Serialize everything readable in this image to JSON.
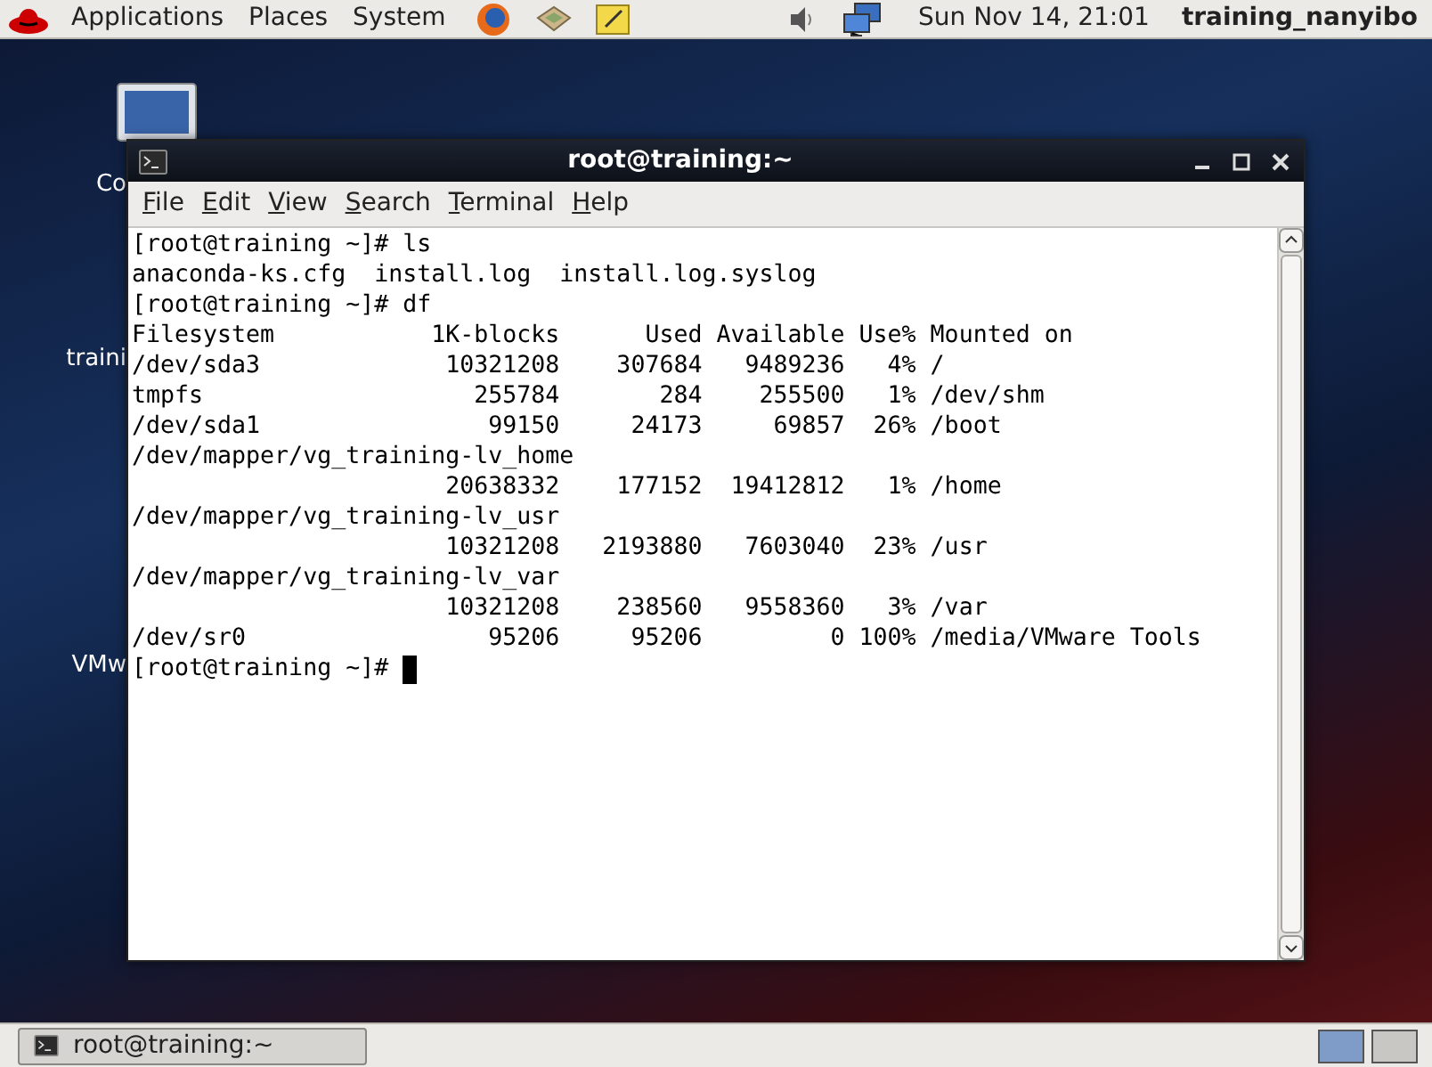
{
  "top_panel": {
    "menus": [
      "Applications",
      "Places",
      "System"
    ],
    "clock": "Sun Nov 14, 21:01",
    "user": "training_nanyibo"
  },
  "desktop_icons": [
    {
      "label": "Co"
    },
    {
      "label": "traini"
    },
    {
      "label": "VMw"
    }
  ],
  "window": {
    "title": "root@training:~",
    "menu": [
      "File",
      "Edit",
      "View",
      "Search",
      "Terminal",
      "Help"
    ],
    "lines": [
      "[root@training ~]# ls",
      "anaconda-ks.cfg  install.log  install.log.syslog",
      "[root@training ~]# df",
      "Filesystem           1K-blocks      Used Available Use% Mounted on",
      "/dev/sda3             10321208    307684   9489236   4% /",
      "tmpfs                   255784       284    255500   1% /dev/shm",
      "/dev/sda1                99150     24173     69857  26% /boot",
      "/dev/mapper/vg_training-lv_home",
      "                      20638332    177152  19412812   1% /home",
      "/dev/mapper/vg_training-lv_usr",
      "                      10321208   2193880   7603040  23% /usr",
      "/dev/mapper/vg_training-lv_var",
      "                      10321208    238560   9558360   3% /var",
      "/dev/sr0                 95206     95206         0 100% /media/VMware Tools"
    ],
    "prompt": "[root@training ~]# "
  },
  "taskbar": {
    "tasks": [
      {
        "label": "root@training:~",
        "selected": false
      }
    ],
    "workspaces": [
      {
        "selected": true
      },
      {
        "selected": false
      }
    ]
  }
}
